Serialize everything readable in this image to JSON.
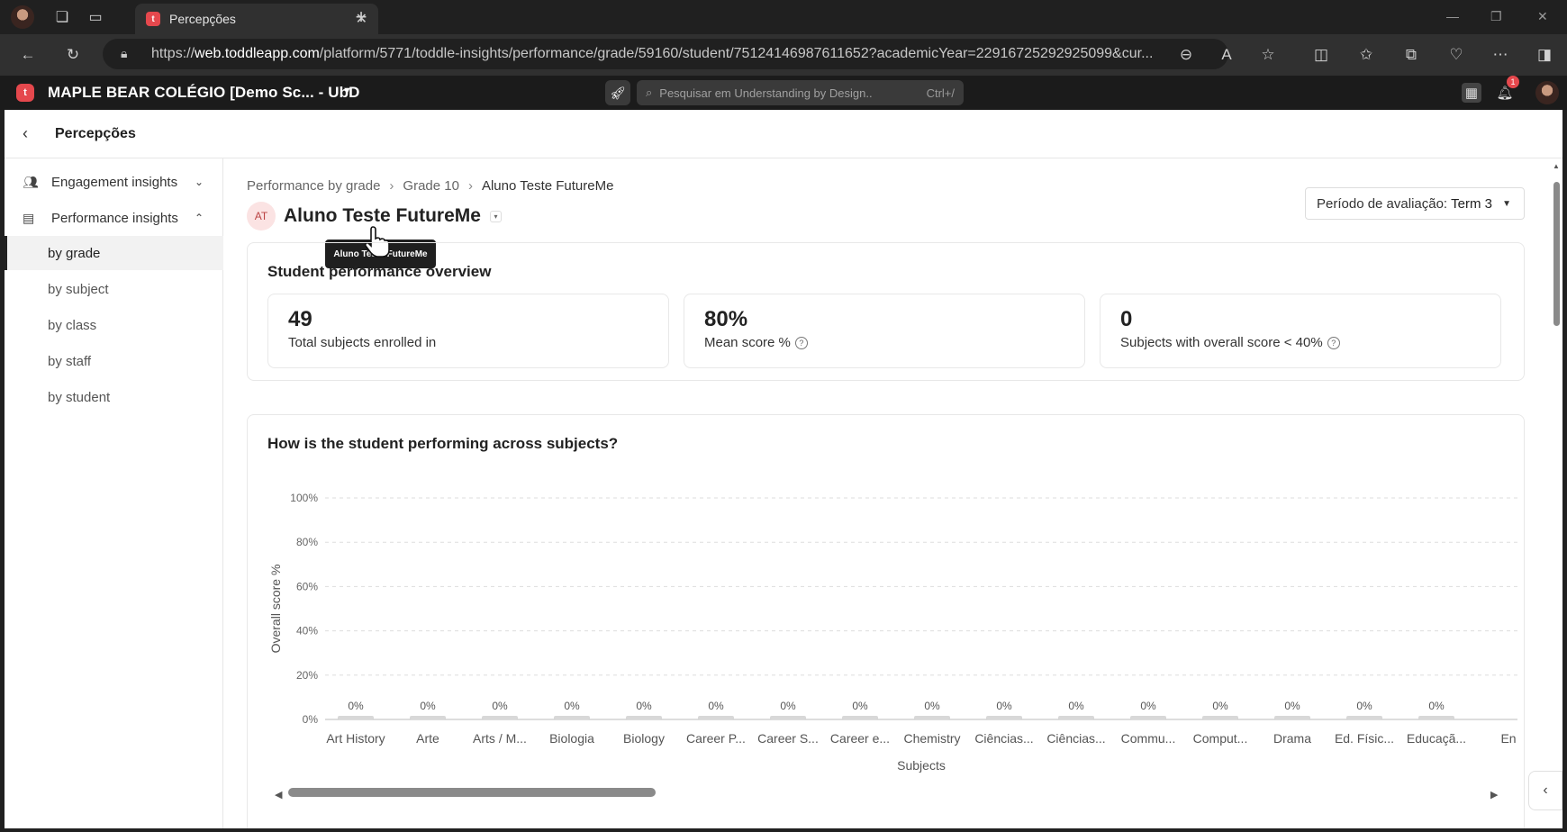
{
  "browser": {
    "tab_title": "Percepções",
    "url_prefix": "https://",
    "url_host": "web.toddleapp.com",
    "url_path": "/platform/5771/toddle-insights/performance/grade/59160/student/7512414698761165​2?academicYear=22916725292925099&cur..."
  },
  "app": {
    "school_name": "MAPLE BEAR COLÉGIO [Demo Sc... - UbD",
    "search_placeholder": "Pesquisar em Understanding by Design..",
    "search_shortcut": "Ctrl+/",
    "notification_count": "1"
  },
  "page": {
    "title": "Percepções"
  },
  "sidebar": {
    "engagement_label": "Engagement insights",
    "performance_label": "Performance insights",
    "sub_items": [
      "by grade",
      "by subject",
      "by class",
      "by staff",
      "by student"
    ]
  },
  "breadcrumb": [
    "Performance by grade",
    "Grade 10",
    "Aluno Teste FutureMe"
  ],
  "student": {
    "initials": "AT",
    "name": "Aluno Teste FutureMe",
    "tooltip": "Aluno Teste FutureMe"
  },
  "period": {
    "label": "Período de avaliação:",
    "value": "Term 3"
  },
  "overview": {
    "title": "Student performance overview",
    "stats": [
      {
        "value": "49",
        "label": "Total subjects enrolled in"
      },
      {
        "value": "80%",
        "label": "Mean score %"
      },
      {
        "value": "0",
        "label": "Subjects with overall score < 40%"
      }
    ]
  },
  "chart_section": {
    "title": "How is the student performing across subjects?"
  },
  "chart_data": {
    "type": "bar",
    "xlabel": "Subjects",
    "ylabel": "Overall score %",
    "ylim": [
      0,
      100
    ],
    "yticks": [
      "0%",
      "20%",
      "40%",
      "60%",
      "80%",
      "100%"
    ],
    "grid": true,
    "categories": [
      "Art History",
      "Arte",
      "Arts / M...",
      "Biologia",
      "Biology",
      "Career P...",
      "Career S...",
      "Career e...",
      "Chemistry",
      "Ciências...",
      "Ciências...",
      "Commu...",
      "Comput...",
      "Drama",
      "Ed. Físic...",
      "Educaçã...",
      "En"
    ],
    "values": [
      0,
      0,
      0,
      0,
      0,
      0,
      0,
      0,
      0,
      0,
      0,
      0,
      0,
      0,
      0,
      0,
      0
    ],
    "data_labels": [
      "0%",
      "0%",
      "0%",
      "0%",
      "0%",
      "0%",
      "0%",
      "0%",
      "0%",
      "0%",
      "0%",
      "0%",
      "0%",
      "0%",
      "0%",
      "0%",
      ""
    ]
  }
}
